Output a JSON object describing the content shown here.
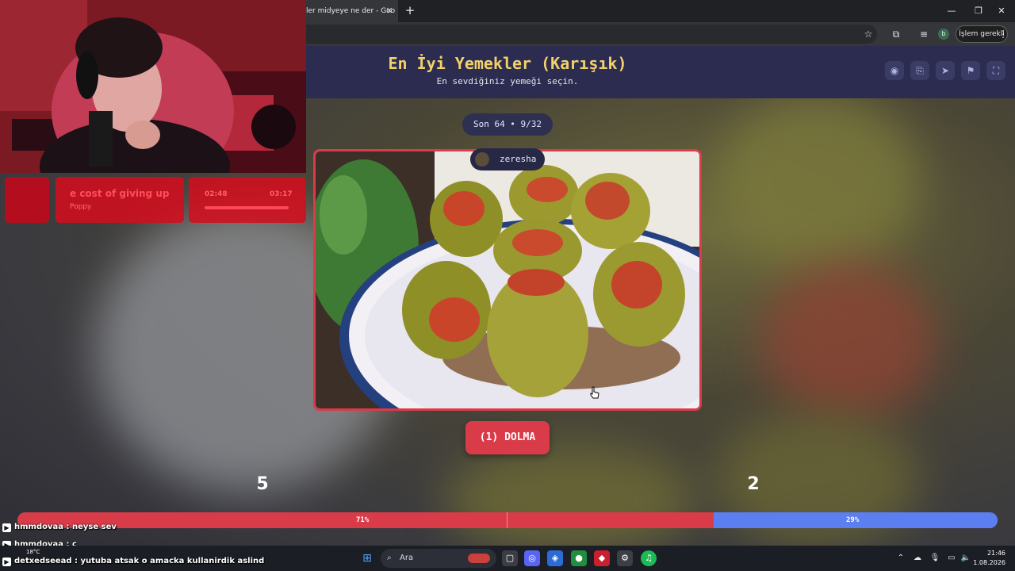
{
  "browser": {
    "tab_title": "ler midyeye ne der - Goo",
    "profile_letter": "b",
    "action_label": "İşlem gerekli"
  },
  "site": {
    "title": "En İyi Yemekler (Karışık)",
    "subtitle": "En sevdiğiniz yemeği seçin.",
    "round": "Son 64 • 9/32"
  },
  "card": {
    "author": "zeresha",
    "choice_label": "(1) DOLMA"
  },
  "votes": {
    "left_count": "5",
    "right_count": "2",
    "left_percent_label": "71%",
    "right_percent_label": "29%",
    "left_fraction": 0.71,
    "right_fraction": 0.29,
    "left_color": "#d93b48",
    "right_color": "#5b7ef0"
  },
  "music": {
    "title": "e cost of giving up",
    "artist": "Poppy",
    "elapsed": "02:48",
    "total": "03:17"
  },
  "chat": [
    {
      "user": "hmmdovaa",
      "message": "neyse sev"
    },
    {
      "user": "hmmdovaa",
      "message": "c"
    },
    {
      "user": "detxedseead",
      "message": "yutuba atsak o amacka kullanirdik aslind"
    }
  ],
  "taskbar": {
    "search": "Ara",
    "time": "21:46",
    "date": "1.08.2026",
    "weather": "18°C"
  }
}
